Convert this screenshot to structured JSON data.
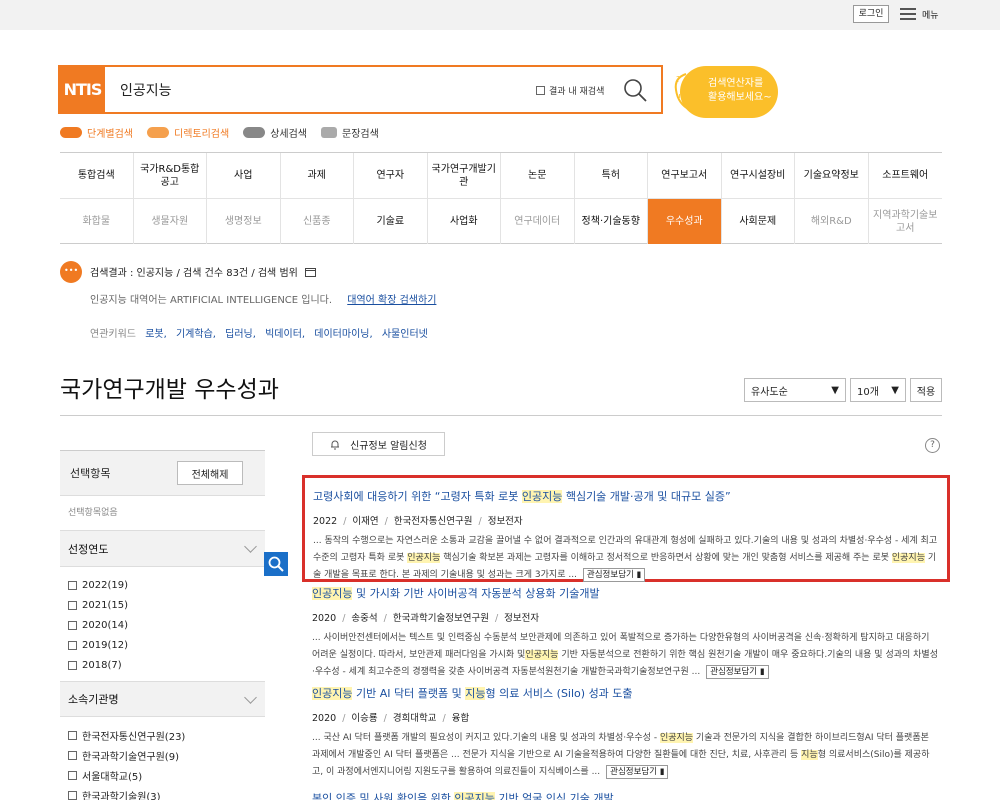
{
  "topbar": {
    "login": "로그인",
    "menu": "메뉴"
  },
  "search": {
    "logo": "NTIS",
    "query": "인공지능",
    "research_label": "결과 내 재검색",
    "bubble_line1": "검색연산자를",
    "bubble_line2": "활용해보세요~"
  },
  "search_types": [
    "단계별검색",
    "디렉토리검색",
    "상세검색",
    "문장검색"
  ],
  "nav": {
    "top": [
      "통합검색",
      "국가R&D통합공고",
      "사업",
      "과제",
      "연구자",
      "국가연구개발기관",
      "논문",
      "특허",
      "연구보고서",
      "연구시설장비",
      "기술요약정보",
      "소프트웨어"
    ],
    "bottom": [
      "화합물",
      "생물자원",
      "생명정보",
      "신품종",
      "기술료",
      "사업화",
      "연구데이터",
      "정책·기술동향",
      "우수성과",
      "사회문제",
      "해외R&D",
      "지역과학기술보고서"
    ],
    "active": "우수성과"
  },
  "info": {
    "summary": "검색결과 : 인공지능  /  검색 건수 83건  /  검색 범위",
    "synonym": "인공지능 대역어는 ARTIFICIAL INTELLIGENCE 입니다.",
    "synonym_link": "대역어 확장 검색하기",
    "related_label": "연관키워드",
    "keywords": [
      "로봇,",
      "기계학습,",
      "딥러닝,",
      "빅데이터,",
      "데이터마이닝,",
      "사물인터넷"
    ]
  },
  "page": {
    "title": "국가연구개발 우수성과",
    "sort": "유사도순",
    "count": "10개",
    "apply": "적용",
    "alert": "신규정보 알림신청"
  },
  "sidebar": {
    "title": "선택항목",
    "reset": "전체해제",
    "empty": "선택항목없음",
    "year_head": "선정연도",
    "years": [
      "2022(19)",
      "2021(15)",
      "2020(14)",
      "2019(12)",
      "2018(7)"
    ],
    "org_head": "소속기관명",
    "orgs": [
      "한국전자통신연구원(23)",
      "한국과학기술연구원(9)",
      "서울대학교(5)",
      "한국과학기술원(3)"
    ]
  },
  "results": [
    {
      "title_pre": "고령사회에 대응하기 위한 “고령자 특화 로봇 ",
      "title_hl": "인공지능",
      "title_post": " 핵심기술 개발·공개 및 대규모 실증”",
      "year": "2022",
      "author": "이재연",
      "org": "한국전자통신연구원",
      "field": "정보전자",
      "abs_a": "... 동작의 수행으로는 자연스러운 소통과 교감을 끌어낼 수 없어 결과적으로 인간과의 유대관계 형성에 실패하고 있다.기술의 내용 및 성과의 차별성·우수성 - 세계 최고 수준의 고령자 특화 로봇 ",
      "abs_hl1": "인공지능",
      "abs_b": " 핵심기술 확보본 과제는 고령자를 이해하고 정서적으로 반응하면서 상황에 맞는 개인 맞춤형 서비스를 제공해 주는 로봇 ",
      "abs_hl2": "인공지능",
      "abs_c": " 기술 개발을 목표로 한다. 본 과제의 기술내용 및 성과는 크게 3가지로 ...",
      "bookmark": "관심정보담기"
    },
    {
      "title_hl": "인공지능",
      "title_post": " 및 가시화 기반 사이버공격 자동분석 상용화 기술개발",
      "year": "2020",
      "author": "송중석",
      "org": "한국과학기술정보연구원",
      "field": "정보전자",
      "abs_a": "... 사이버안전센터에서는 텍스트 및 인력중심 수동분석 보안관제에 의존하고 있어 폭발적으로 증가하는 다양한유형의 사이버공격을 신속·정확하게 탐지하고 대응하기 어려운 실정이다. 따라서, 보안관제 패러다임을 가시화 및",
      "abs_hl1": "인공지능",
      "abs_b": " 기반 자동분석으로 전환하기 위한 핵심 원천기술 개발이 매우 중요하다.기술의 내용 및 성과의 차별성·우수성 - 세계 최고수준의 경쟁력을 갖춘 사이버공격 자동분석원천기술 개발한국과학기술정보연구원 ...",
      "bookmark": "관심정보담기"
    },
    {
      "title_hl": "인공지능",
      "title_mid": " 기반 AI 닥터 플랫폼 및 ",
      "title_hl2": "지능",
      "title_post": "형 의료 서비스 (Silo) 성과 도출",
      "year": "2020",
      "author": "이승룡",
      "org": "경희대학교",
      "field": "융합",
      "abs_a": "... 국산 AI 닥터 플랫폼 개발의 필요성이 커지고 있다.기술의 내용 및 성과의 차별성·우수성 - ",
      "abs_hl1": "인공지능",
      "abs_b": " 기술과 전문가의 지식을 결합한 하이브리드형AI 닥터 플랫폼본 과제에서 개발중인 AI 닥터 플랫폼은 ... 전문가 지식을 기반으로 AI 기술을적용하여 다양한 질환들에 대한 진단, 치료, 사후관리 등 ",
      "abs_hl2": "지능",
      "abs_c": "형 의료서비스(Silo)를 제공하고, 이 과정에서엔지니어링 지원도구를 활용하여 의료진들이 지식베이스를 ...",
      "bookmark": "관심정보담기"
    },
    {
      "title_pre": "본인 인증 및 사원 확인을 위한 ",
      "title_hl": "인공지능",
      "title_post": " 기반 얼굴 인식 기술 개발"
    }
  ]
}
